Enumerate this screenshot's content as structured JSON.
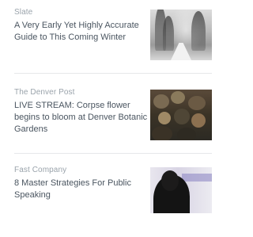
{
  "feed": {
    "items": [
      {
        "source": "Slate",
        "headline": "A Very Early Yet Highly Accurate Guide to This Coming Winter",
        "thumbnail_icon": "winter-road-photo"
      },
      {
        "source": "The Denver Post",
        "headline": "LIVE STREAM: Corpse flower begins to bloom at Denver Botanic Gardens",
        "thumbnail_icon": "crowd-gardens-photo"
      },
      {
        "source": "Fast Company",
        "headline": "8 Master Strategies For Public Speaking",
        "thumbnail_icon": "speaker-photo"
      }
    ]
  }
}
